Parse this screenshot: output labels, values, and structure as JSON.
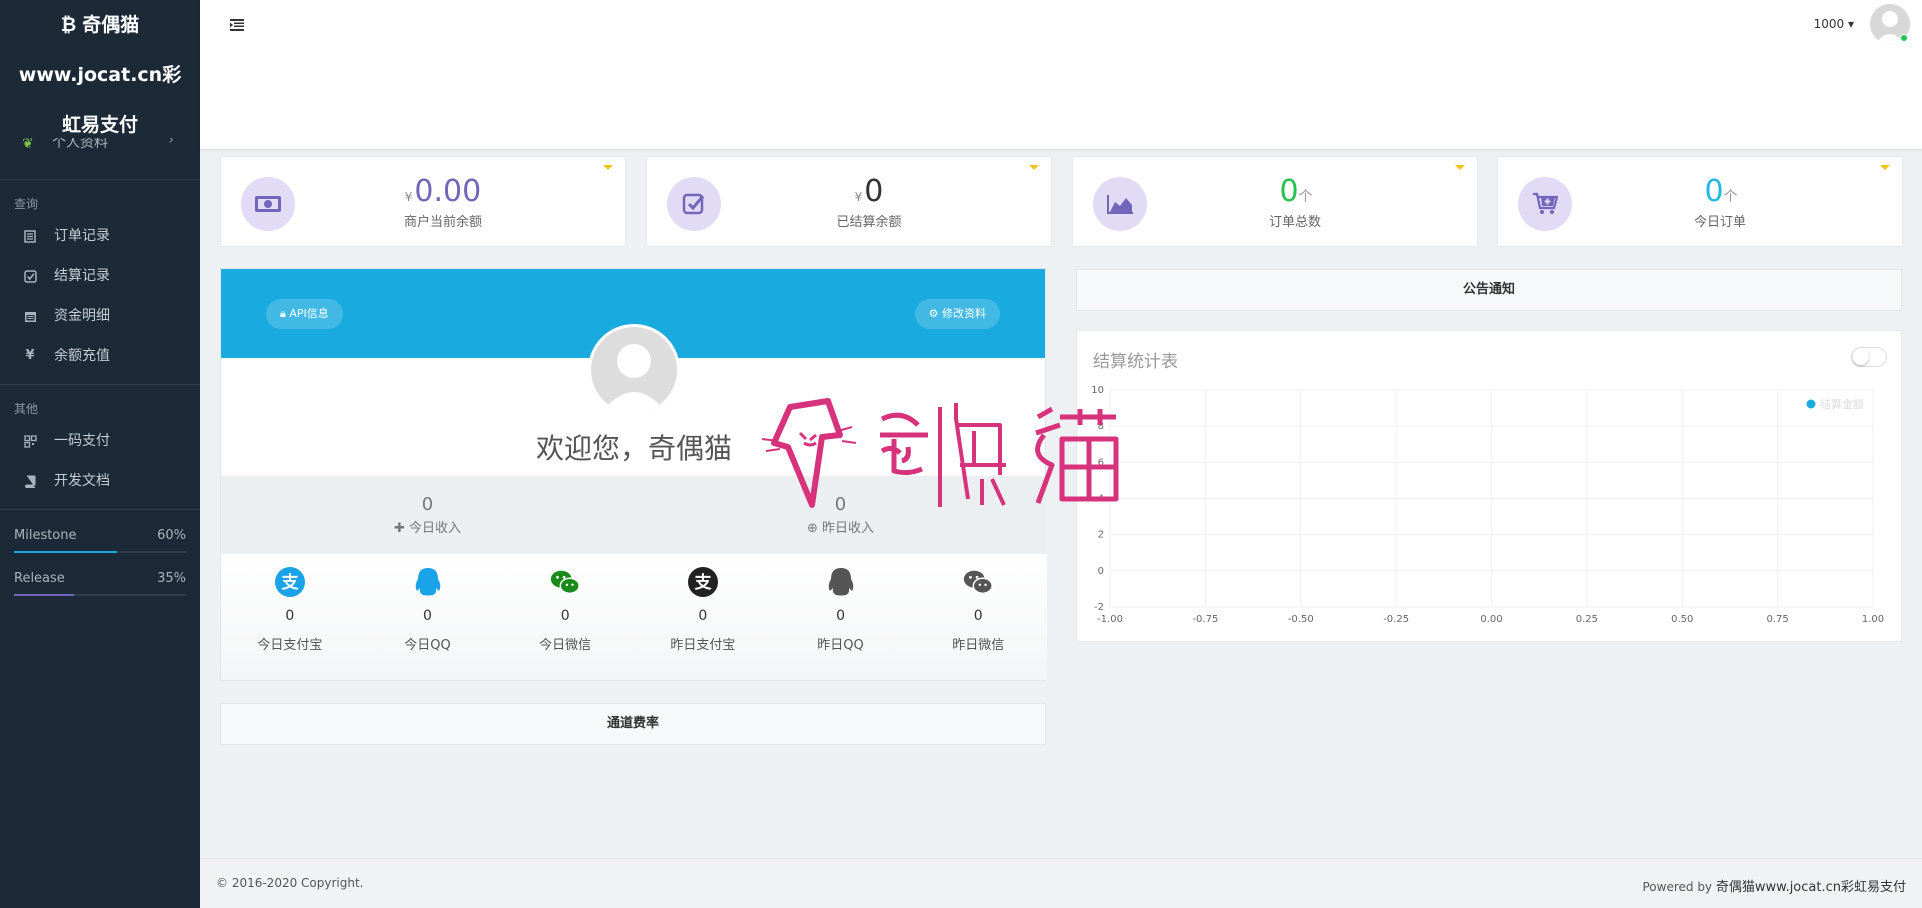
{
  "sidebar": {
    "brand_line1": "奇偶猫",
    "brand_line2": "www.jocat.cn彩",
    "brand_line3": "虹易支付",
    "partial_item": "个人资料",
    "section_query": "查询",
    "items_query": [
      {
        "label": "订单记录",
        "icon": "list-icon"
      },
      {
        "label": "结算记录",
        "icon": "check-square-icon"
      },
      {
        "label": "资金明细",
        "icon": "calendar-icon"
      },
      {
        "label": "余额充值",
        "icon": "yen-icon"
      }
    ],
    "section_other": "其他",
    "items_other": [
      {
        "label": "一码支付",
        "icon": "qrcode-icon"
      },
      {
        "label": "开发文档",
        "icon": "book-icon"
      }
    ],
    "progress": [
      {
        "label": "Milestone",
        "value": "60%",
        "fraction": 0.6,
        "color": "#19aadf"
      },
      {
        "label": "Release",
        "value": "35%",
        "fraction": 0.35,
        "color": "#7266ba"
      }
    ]
  },
  "topbar": {
    "user_number": "1000"
  },
  "stats": [
    {
      "prefix": "¥",
      "value": "0.00",
      "suffix": "",
      "label": "商户当前余额",
      "color": "#7266ba",
      "icon": "money-icon"
    },
    {
      "prefix": "¥",
      "value": "0",
      "suffix": "",
      "label": "已结算余额",
      "color": "#333333",
      "icon": "check-square-icon"
    },
    {
      "prefix": "",
      "value": "0",
      "suffix": "个",
      "label": "订单总数",
      "color": "#27c24c",
      "icon": "area-chart-icon"
    },
    {
      "prefix": "",
      "value": "0",
      "suffix": "个",
      "label": "今日订单",
      "color": "#23b7e5",
      "icon": "cart-plus-icon"
    }
  ],
  "profile": {
    "api_button": "API信息",
    "edit_button": "修改资料",
    "welcome": "欢迎您，奇偶猫",
    "today_income_value": "0",
    "today_income_label": "今日收入",
    "yesterday_income_value": "0",
    "yesterday_income_label": "昨日收入",
    "channels": [
      {
        "value": "0",
        "label": "今日支付宝",
        "icon": "alipay-icon",
        "color": "#1aa3e8"
      },
      {
        "value": "0",
        "label": "今日QQ",
        "icon": "qq-icon",
        "color": "#1aa3e8"
      },
      {
        "value": "0",
        "label": "今日微信",
        "icon": "wechat-icon",
        "color": "#1a8a1a"
      },
      {
        "value": "0",
        "label": "昨日支付宝",
        "icon": "alipay-icon",
        "color": "#222222"
      },
      {
        "value": "0",
        "label": "昨日QQ",
        "icon": "qq-icon",
        "color": "#555555"
      },
      {
        "value": "0",
        "label": "昨日微信",
        "icon": "wechat-icon",
        "color": "#555555"
      }
    ]
  },
  "rate_panel": "通道费率",
  "notice_panel": "公告通知",
  "chart_data": {
    "type": "line",
    "title": "结算统计表",
    "series": [
      {
        "name": "结算金额",
        "values": []
      }
    ],
    "x_ticks": [
      "-1.00",
      "-0.75",
      "-0.50",
      "-0.25",
      "0.00",
      "0.25",
      "0.50",
      "0.75",
      "1.00"
    ],
    "y_ticks": [
      "10",
      "8",
      "6",
      "4",
      "2",
      "0",
      "-2"
    ],
    "xlim": [
      -1,
      1
    ],
    "ylim": [
      -2,
      10
    ],
    "grid": true,
    "legend": "top-right"
  },
  "footer": {
    "copyright": "© 2016-2020 Copyright.",
    "powered_prefix": "Powered by ",
    "powered_name": "奇偶猫www.jocat.cn彩虹易支付"
  },
  "watermark_text": "奇偶猫"
}
